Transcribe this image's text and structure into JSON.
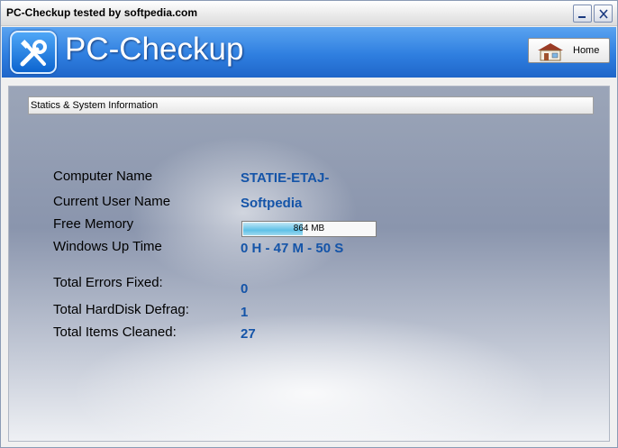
{
  "window": {
    "title": "PC-Checkup tested by softpedia.com"
  },
  "header": {
    "app_name": "PC-Checkup",
    "home_label": "Home"
  },
  "section": {
    "title": "Statics & System Information"
  },
  "info": {
    "computer_name_label": "Computer Name",
    "computer_name_value": "STATIE-ETAJ-",
    "user_name_label": "Current User Name",
    "user_name_value": "Softpedia",
    "free_memory_label": "Free Memory",
    "free_memory_value": "864 MB",
    "free_memory_fraction": 0.45,
    "uptime_label": "Windows Up Time",
    "uptime_value": "0 H - 47 M - 50 S",
    "errors_fixed_label": "Total Errors Fixed:",
    "errors_fixed_value": "0",
    "defrag_label": "Total HardDisk Defrag:",
    "defrag_value": "1",
    "cleaned_label": "Total Items Cleaned:",
    "cleaned_value": "27"
  },
  "colors": {
    "value_text": "#1454a8",
    "header_blue": "#2f7fe0"
  },
  "icons": {
    "logo": "tools-icon",
    "home": "home-icon",
    "minimize": "minimize-icon",
    "close": "close-icon"
  }
}
